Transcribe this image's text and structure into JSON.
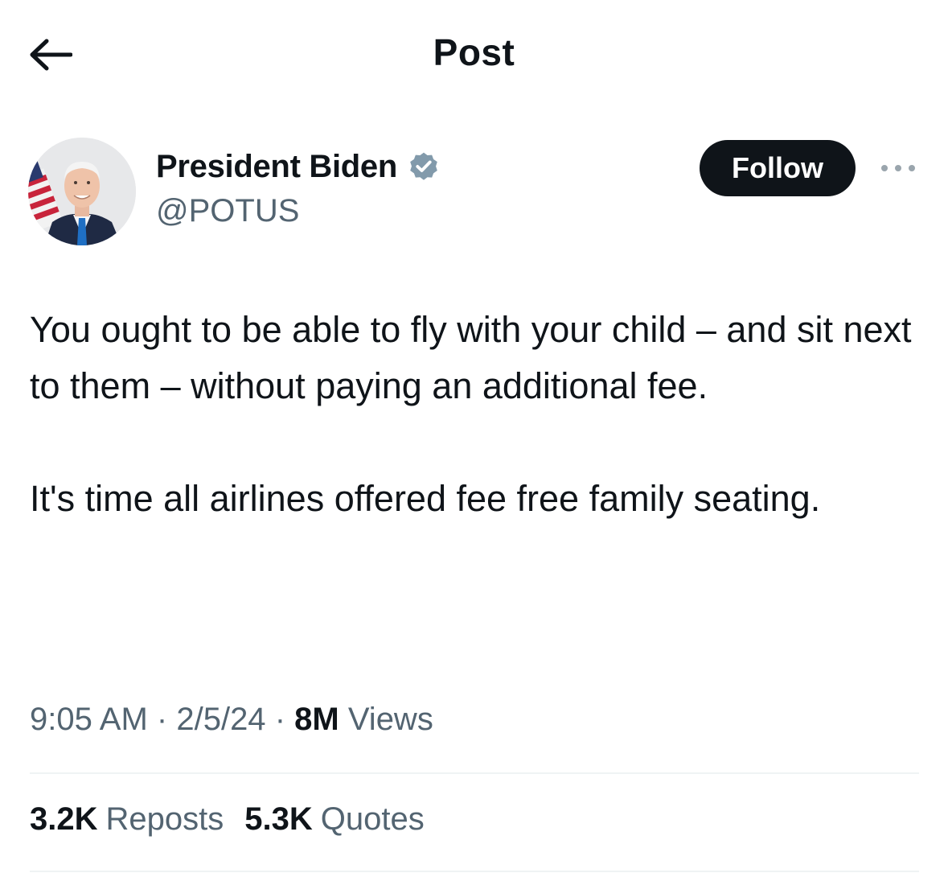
{
  "header": {
    "back_icon": "arrow-left-icon",
    "title": "Post"
  },
  "author": {
    "name": "President Biden",
    "handle": "@POTUS",
    "verified": true,
    "verified_icon": "verified-badge-icon",
    "badge_color": "#829aab",
    "follow_label": "Follow",
    "more_icon": "more-options-icon"
  },
  "post": {
    "paragraphs": [
      "You ought to be able to fly with your child – and sit next to them – without paying an additional fee.",
      "It's time all airlines offered fee free family seating."
    ]
  },
  "meta": {
    "time": "9:05 AM",
    "separator": "·",
    "date": "2/5/24",
    "views_count": "8M",
    "views_label": "Views"
  },
  "stats": {
    "reposts_count": "3.2K",
    "reposts_label": "Reposts",
    "quotes_count": "5.3K",
    "quotes_label": "Quotes"
  },
  "colors": {
    "text_primary": "#0f1419",
    "text_secondary": "#536471",
    "follow_bg": "#0f1419",
    "divider": "#eff3f4"
  }
}
